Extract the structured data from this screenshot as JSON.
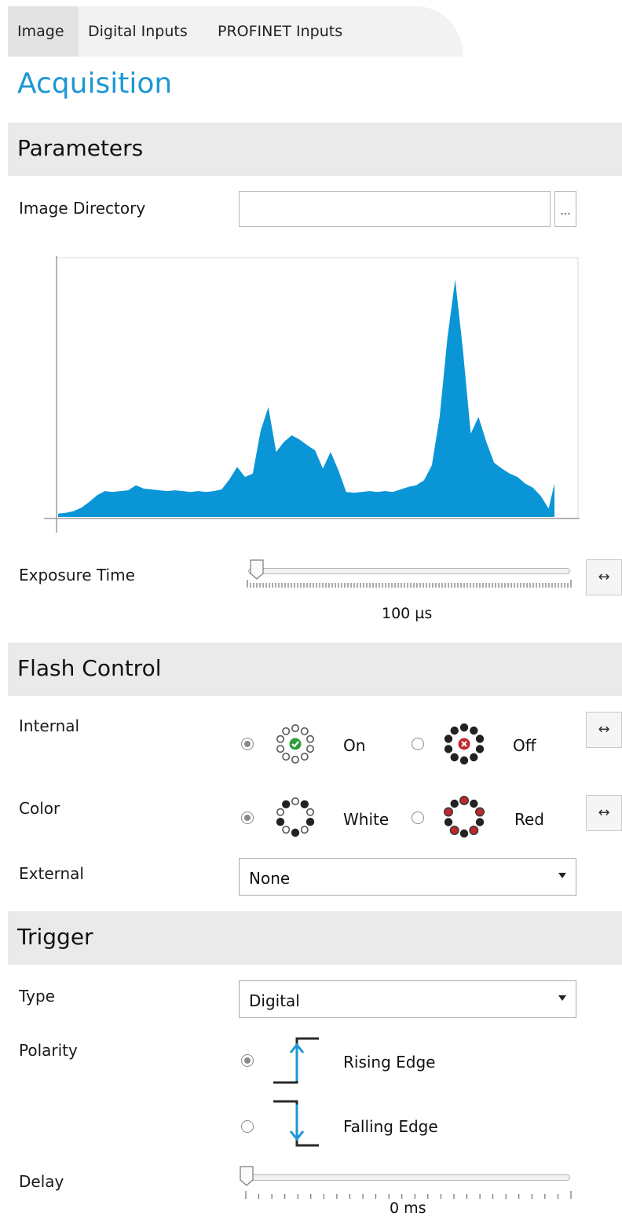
{
  "tabs": [
    {
      "label": "Image",
      "active": true
    },
    {
      "label": "Digital Inputs",
      "active": false
    },
    {
      "label": "PROFINET Inputs",
      "active": false
    }
  ],
  "page_title": "Acquisition",
  "sections": {
    "parameters": "Parameters",
    "flash_control": "Flash Control",
    "trigger": "Trigger"
  },
  "parameters": {
    "image_directory_label": "Image Directory",
    "image_directory_value": "",
    "browse_label": "...",
    "exposure_label": "Exposure Time",
    "exposure_value": "100 µs",
    "exposure_slider_fraction": 0.02
  },
  "flash": {
    "internal_label": "Internal",
    "internal_options": [
      {
        "label": "On",
        "checked": true,
        "icon": "led-ring-on-icon"
      },
      {
        "label": "Off",
        "checked": false,
        "icon": "led-ring-off-icon"
      }
    ],
    "color_label": "Color",
    "color_options": [
      {
        "label": "White",
        "checked": true,
        "icon": "led-ring-white-icon"
      },
      {
        "label": "Red",
        "checked": false,
        "icon": "led-ring-red-icon"
      }
    ],
    "external_label": "External",
    "external_value": "None"
  },
  "trigger": {
    "type_label": "Type",
    "type_value": "Digital",
    "polarity_label": "Polarity",
    "polarity_options": [
      {
        "label": "Rising Edge",
        "checked": true,
        "icon": "rising-edge-icon"
      },
      {
        "label": "Falling Edge",
        "checked": false,
        "icon": "falling-edge-icon"
      }
    ],
    "delay_label": "Delay",
    "delay_value": "0 ms",
    "delay_slider_fraction": 0.0
  },
  "colors": {
    "accent": "#1d97d4",
    "histogram_fill": "#0a96d6",
    "led_green": "#2e9d3a",
    "led_red": "#c0282d"
  },
  "chart_data": {
    "type": "area",
    "title": "",
    "xlabel": "",
    "ylabel": "",
    "x": [
      0,
      4,
      8,
      12,
      16,
      20,
      24,
      28,
      32,
      36,
      40,
      44,
      48,
      52,
      56,
      60,
      64,
      68,
      72,
      76,
      80,
      84,
      88,
      92,
      96,
      100,
      104,
      108,
      112,
      116,
      120,
      124,
      128,
      132,
      136,
      140,
      144,
      148,
      152,
      156,
      160,
      164,
      168,
      172,
      176,
      180,
      184,
      188,
      192,
      196,
      200,
      204,
      208,
      212,
      216,
      220,
      224,
      228,
      232,
      236,
      240,
      244,
      248,
      252,
      255
    ],
    "values": [
      4,
      5,
      7,
      11,
      18,
      26,
      31,
      30,
      31,
      32,
      38,
      34,
      33,
      32,
      31,
      32,
      31,
      30,
      31,
      30,
      31,
      33,
      45,
      60,
      48,
      52,
      103,
      132,
      78,
      90,
      98,
      93,
      86,
      80,
      58,
      78,
      56,
      30,
      29,
      30,
      31,
      30,
      31,
      30,
      33,
      36,
      38,
      44,
      62,
      120,
      215,
      285,
      200,
      100,
      120,
      90,
      65,
      58,
      52,
      48,
      40,
      35,
      25,
      10,
      40
    ],
    "ylim": [
      0,
      300
    ],
    "xlim": [
      0,
      255
    ]
  }
}
